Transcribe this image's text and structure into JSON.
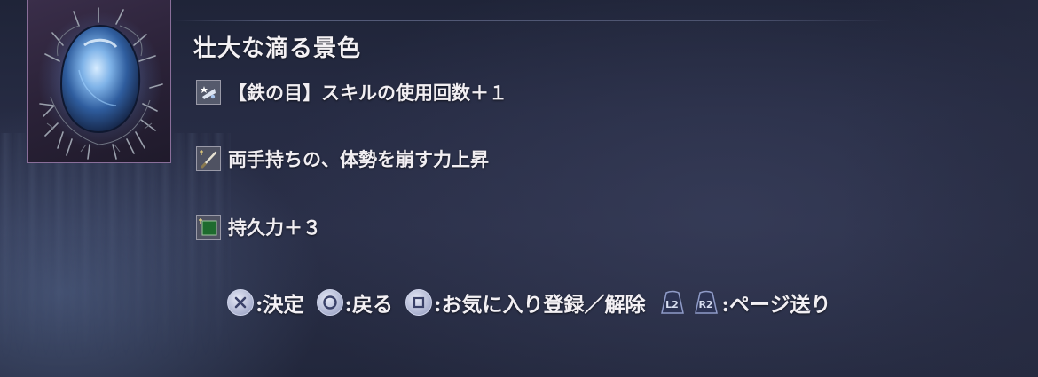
{
  "item": {
    "title": "壮大な滴る景色",
    "image_icon": "drop-crystal-icon"
  },
  "effects": [
    {
      "icon": "iron-eye-skill-icon",
      "text": "【鉄の目】スキルの使用回数＋１"
    },
    {
      "icon": "two-handed-sword-icon",
      "text": "両手持ちの、体勢を崩す力上昇"
    },
    {
      "icon": "stamina-green-icon",
      "text": "持久力＋３"
    }
  ],
  "footer": {
    "confirm_label": ":決定",
    "back_label": ":戻る",
    "favorite_label": ":お気に入り登録／解除",
    "l2": "L2",
    "r2": "R2",
    "page_label": ":ページ送り"
  },
  "colors": {
    "accent_frame": "#8a6f9a",
    "text": "#f1eef2",
    "button_glyph": "#aab1cf",
    "stamina_green": "#1e6b2e"
  }
}
